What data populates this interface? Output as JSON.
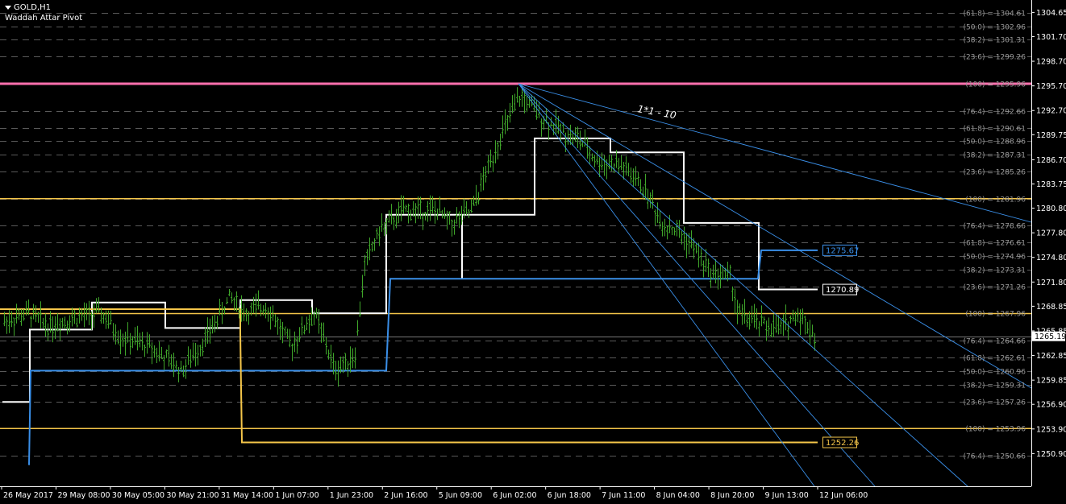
{
  "window": {
    "symbol_label": "GOLD,H1",
    "indicator_label": "Waddah Attar Pivot"
  },
  "colors": {
    "background": "#000000",
    "candle": "#3fa52a",
    "grid": "#5a5a5a",
    "pivot_pink": "#ff6fae",
    "pivot_yellow": "#f5c64a",
    "pivot_white": "#ffffff",
    "pivot_blue": "#3a8fe8",
    "fan_blue": "#3a8fe8",
    "fib_text": "#9a9a9a",
    "axis_text": "#ffffff"
  },
  "chart_data": {
    "type": "candlestick",
    "y_range": [
      1249.5,
      1306.0
    ],
    "price_axis_labels": [
      "1304.65",
      "1301.70",
      "1298.70",
      "1295.70",
      "1292.70",
      "1289.75",
      "1286.70",
      "1283.75",
      "1280.80",
      "1277.80",
      "1274.80",
      "1271.80",
      "1268.85",
      "1265.85",
      "1262.85",
      "1259.85",
      "1256.90",
      "1253.90",
      "1250.90"
    ],
    "time_axis_labels": [
      "26 May 2017",
      "29 May 08:00",
      "30 May 05:00",
      "30 May 21:00",
      "31 May 14:00",
      "1 Jun 07:00",
      "1 Jun 23:00",
      "2 Jun 16:00",
      "5 Jun 09:00",
      "6 Jun 02:00",
      "6 Jun 18:00",
      "7 Jun 11:00",
      "8 Jun 04:00",
      "8 Jun 20:00",
      "9 Jun 13:00",
      "12 Jun 06:00"
    ],
    "current_price": "1265.19",
    "fib_levels": [
      {
        "text": "(61.8) = 1304.61",
        "price": 1304.61
      },
      {
        "text": "(50.0) = 1302.96",
        "price": 1302.96
      },
      {
        "text": "(38.2) = 1301.31",
        "price": 1301.31
      },
      {
        "text": "(23.6) = 1299.26",
        "price": 1299.26
      },
      {
        "text": "(100) = 1295.96",
        "price": 1295.96
      },
      {
        "text": "(76.4) = 1292.66",
        "price": 1292.66
      },
      {
        "text": "(61.8) = 1290.61",
        "price": 1290.61
      },
      {
        "text": "(50.0) = 1288.96",
        "price": 1288.96
      },
      {
        "text": "(38.2) = 1287.31",
        "price": 1287.31
      },
      {
        "text": "(23.6) = 1285.26",
        "price": 1285.26
      },
      {
        "text": "(100) = 1281.96",
        "price": 1281.96
      },
      {
        "text": "(76.4) = 1278.66",
        "price": 1278.66
      },
      {
        "text": "(61.8) = 1276.61",
        "price": 1276.61
      },
      {
        "text": "(50.0) = 1274.96",
        "price": 1274.96
      },
      {
        "text": "(38.2) = 1273.31",
        "price": 1273.31
      },
      {
        "text": "(23.6) = 1271.26",
        "price": 1271.26
      },
      {
        "text": "(100) = 1267.96",
        "price": 1267.96
      },
      {
        "text": "(76.4) = 1264.66",
        "price": 1264.66
      },
      {
        "text": "(61.8) = 1262.61",
        "price": 1262.61
      },
      {
        "text": "(50.0) = 1260.96",
        "price": 1260.96
      },
      {
        "text": "(38.2) = 1259.31",
        "price": 1259.31
      },
      {
        "text": "(23.6) = 1257.26",
        "price": 1257.26
      },
      {
        "text": "(100) = 1253.96",
        "price": 1253.96
      },
      {
        "text": "(76.4) = 1250.66",
        "price": 1250.66
      }
    ],
    "horizontal_lines": [
      {
        "price": 1295.96,
        "color": "pink",
        "thick": true
      },
      {
        "price": 1281.96,
        "color": "yellow"
      },
      {
        "price": 1267.96,
        "color": "yellow"
      },
      {
        "price": 1253.96,
        "color": "yellow"
      }
    ],
    "pivot_labels": [
      {
        "text": "1275.67",
        "color": "blue",
        "price": 1275.67
      },
      {
        "text": "1270.89",
        "color": "white",
        "price": 1270.89
      },
      {
        "text": "1252.26",
        "color": "yellow",
        "price": 1252.26
      }
    ],
    "fan_label": "1*1 - 10"
  }
}
